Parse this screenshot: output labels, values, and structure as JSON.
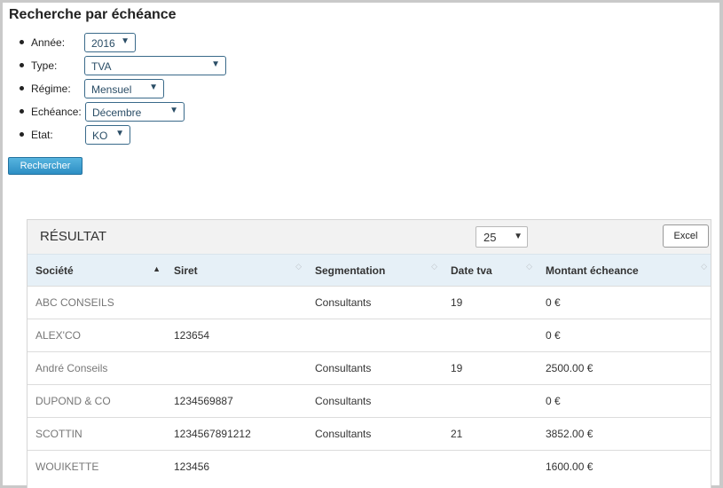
{
  "page": {
    "title": "Recherche par échéance"
  },
  "filters": {
    "annee": {
      "label": "Année:",
      "value": "2016"
    },
    "type": {
      "label": "Type:",
      "value": "TVA"
    },
    "regime": {
      "label": "Régime:",
      "value": "Mensuel"
    },
    "echeance": {
      "label": "Echéance:",
      "value": "Décembre"
    },
    "etat": {
      "label": "Etat:",
      "value": "KO"
    }
  },
  "search_button": "Rechercher",
  "result": {
    "title": "RÉSULTAT",
    "page_size": "25",
    "excel_button": "Excel",
    "columns": [
      "Société",
      "Siret",
      "Segmentation",
      "Date tva",
      "Montant écheance"
    ],
    "sort": {
      "column": "Société",
      "direction": "asc"
    },
    "rows": [
      [
        "ABC CONSEILS",
        "",
        "Consultants",
        "19",
        "0 €"
      ],
      [
        "ALEX'CO",
        "123654",
        "",
        "",
        "0 €"
      ],
      [
        "André Conseils",
        "",
        "Consultants",
        "19",
        "2500.00 €"
      ],
      [
        "DUPOND & CO",
        "1234569887",
        "Consultants",
        "",
        "0 €"
      ],
      [
        "SCOTTIN",
        "1234567891212",
        "Consultants",
        "21",
        "3852.00 €"
      ],
      [
        "WOUIKETTE",
        "123456",
        "",
        "",
        "1600.00 €"
      ]
    ]
  },
  "icons": {
    "dropdown": "chevron-down-icon",
    "sort_asc": "sort-asc-icon",
    "sort_neutral": "sort-icon"
  }
}
